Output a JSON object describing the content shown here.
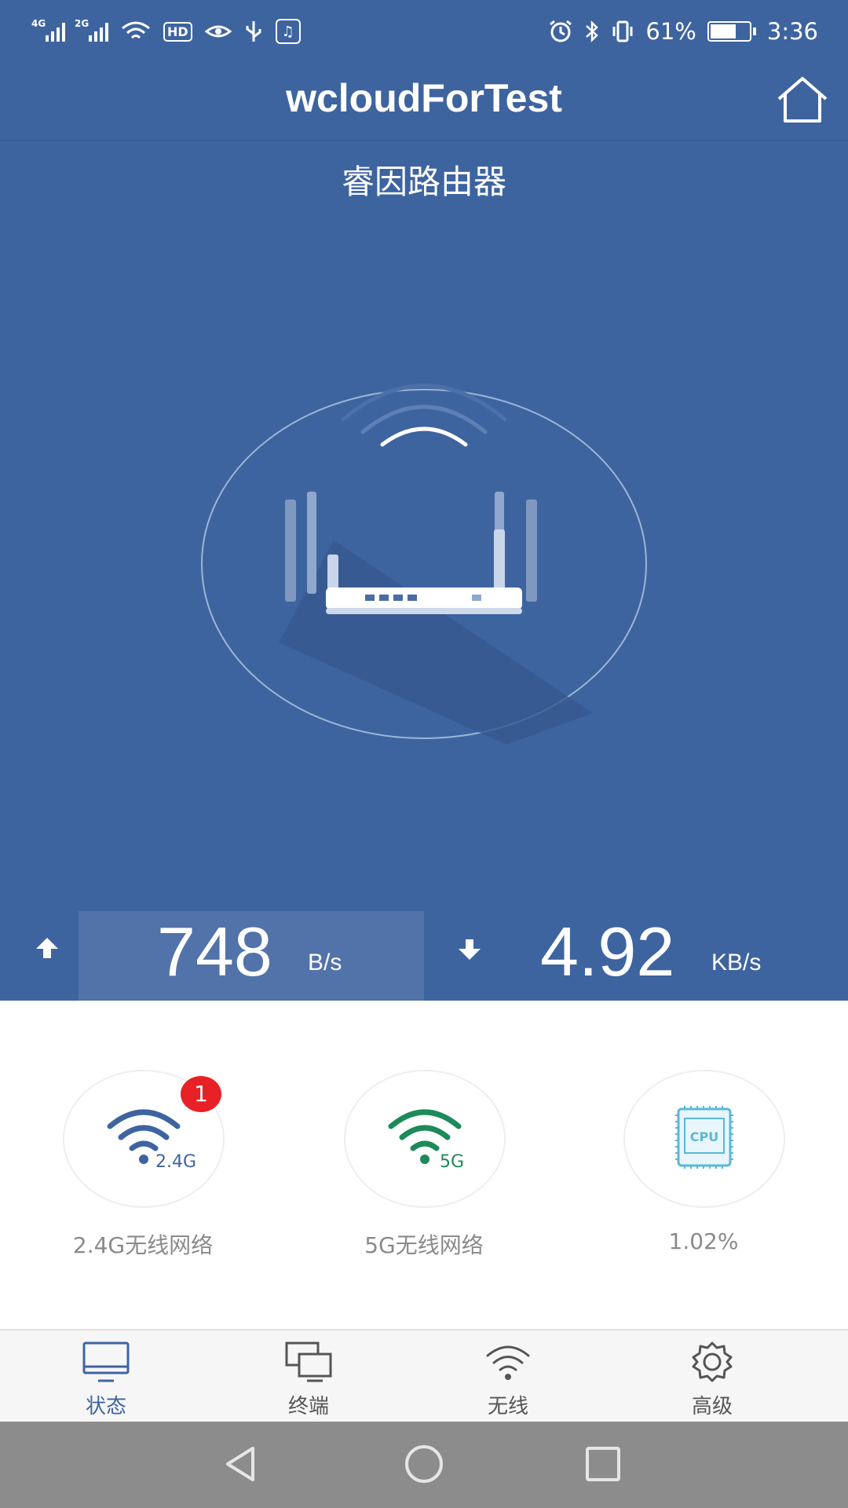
{
  "status_bar": {
    "signal1_label": "4G",
    "signal2_label": "2G",
    "hd_label": "HD",
    "battery_percent": "61%",
    "battery_level": 0.61,
    "time": "3:36",
    "icons": [
      "signal-4g-icon",
      "signal-2g-icon",
      "wifi-icon",
      "hd-icon",
      "eye-icon",
      "usb-icon",
      "music-app-icon",
      "alarm-icon",
      "bluetooth-icon",
      "vibrate-icon",
      "battery-icon"
    ]
  },
  "header": {
    "title": "wcloudForTest",
    "home_icon": "home-icon"
  },
  "device": {
    "name": "睿因路由器"
  },
  "speed": {
    "upload": {
      "value": "748",
      "unit": "B/s"
    },
    "download": {
      "value": "4.92",
      "unit": "KB/s"
    }
  },
  "features": [
    {
      "label": "2.4G无线网络",
      "icon_text": "2.4G",
      "badge": "1",
      "icon": "wifi-24g-icon",
      "color": "#3e64a0"
    },
    {
      "label": "5G无线网络",
      "icon_text": "5G",
      "icon": "wifi-5g-icon",
      "color": "#1d8a5a"
    },
    {
      "label": "1.02%",
      "icon_text": "CPU",
      "icon": "cpu-icon",
      "color": "#5ab8d6"
    }
  ],
  "tabs": [
    {
      "label": "状态",
      "icon": "monitor-icon",
      "active": true
    },
    {
      "label": "终端",
      "icon": "devices-icon",
      "active": false
    },
    {
      "label": "无线",
      "icon": "wifi-icon",
      "active": false
    },
    {
      "label": "高级",
      "icon": "gear-icon",
      "active": false
    }
  ],
  "colors": {
    "primary": "#3e64a0",
    "badge": "#e82126",
    "green": "#1d8a5a",
    "cpu": "#5ab8d6"
  }
}
